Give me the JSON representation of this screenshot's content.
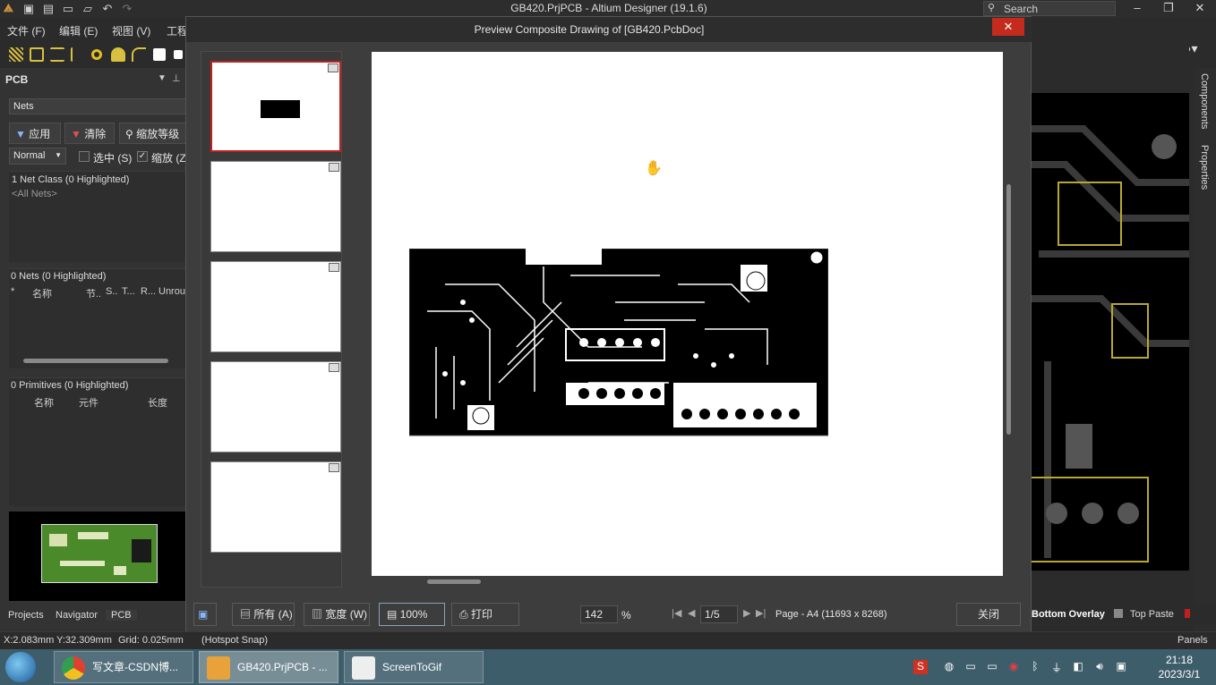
{
  "window": {
    "title": "GB420.PrjPCB - Altium Designer (19.1.6)",
    "search_placeholder": "Search"
  },
  "menu": {
    "items": [
      "文件 (F)",
      "编辑 (E)",
      "视图 (V)",
      "工程"
    ]
  },
  "left_panel": {
    "title": "PCB",
    "mode_select": "Nets",
    "buttons": {
      "apply": "应用",
      "clear": "清除",
      "zoom_level": "缩放等级"
    },
    "normal_select": "Normal",
    "select_checkbox": "选中 (S)",
    "zoom_checkbox": "缩放 (Z",
    "net_class_title": "1 Net Class (0 Highlighted)",
    "net_class_item": "<All Nets>",
    "nets_title": "0 Nets (0 Highlighted)",
    "nets_columns": [
      "*",
      "名称",
      "节..",
      "S..",
      "T...",
      "R...",
      "Unrou"
    ],
    "primitives_title": "0 Primitives (0 Highlighted)",
    "primitives_columns": [
      "名称",
      "元件",
      "长度"
    ]
  },
  "bottom_tabs": [
    "Projects",
    "Navigator",
    "PCB"
  ],
  "dialog": {
    "title": "Preview Composite Drawing of [GB420.PcbDoc]",
    "buttons": {
      "all": "所有 (A)",
      "width": "宽度 (W)",
      "hundred": "100%",
      "print": "打印 (P)...",
      "close": "关闭"
    },
    "zoom_value": "142",
    "zoom_unit": "%",
    "page_value": "1/5",
    "page_info": "Page - A4 (11693 x 8268)"
  },
  "right_side_tabs": [
    "Components",
    "Properties"
  ],
  "layer_tabs": [
    "Bottom Overlay",
    "Top Paste"
  ],
  "status": {
    "coords": "X:2.083mm Y:32.309mm",
    "grid": "Grid: 0.025mm",
    "snap": "(Hotspot Snap)",
    "panels": "Panels"
  },
  "taskbar": {
    "tasks": [
      "写文章-CSDN博...",
      "GB420.PrjPCB - ...",
      "ScreenToGif"
    ],
    "time": "21:18",
    "date": "2023/3/1"
  }
}
